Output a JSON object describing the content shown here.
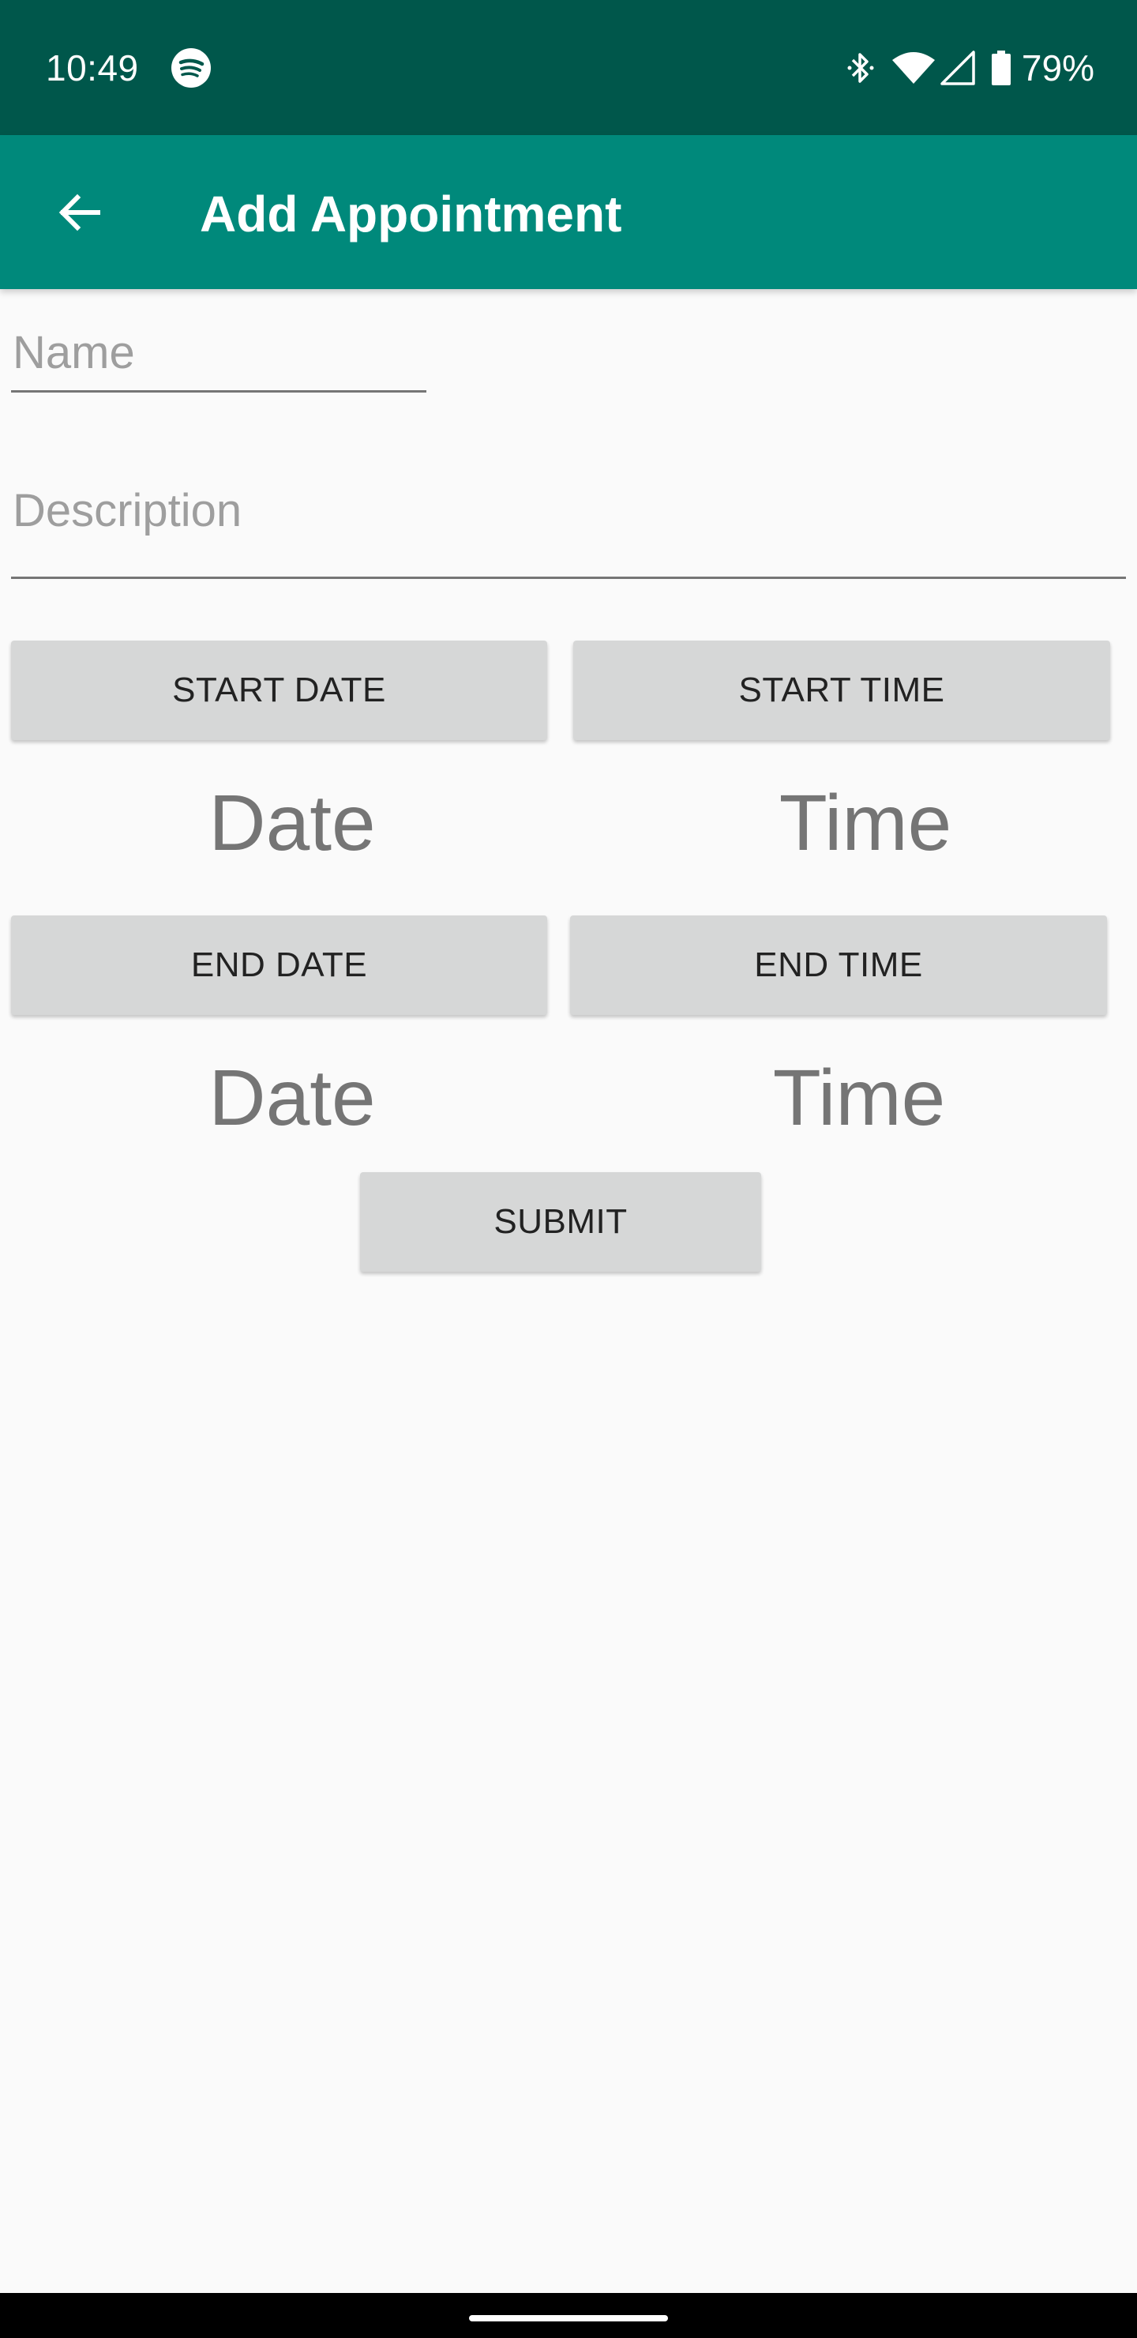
{
  "status_bar": {
    "time": "10:49",
    "battery": "79%",
    "icons": [
      "spotify-icon",
      "bluetooth-icon",
      "wifi-icon",
      "signal-icon",
      "battery-icon"
    ]
  },
  "app_bar": {
    "title": "Add Appointment",
    "back_icon": "arrow-back-icon",
    "color": "#00897b"
  },
  "form": {
    "name_placeholder": "Name",
    "description_placeholder": "Description",
    "start_date_button": "START DATE",
    "start_time_button": "START TIME",
    "start_date_value": "Date",
    "start_time_value": "Time",
    "end_date_button": "END DATE",
    "end_time_button": "END TIME",
    "end_date_value": "Date",
    "end_time_value": "Time",
    "submit_button": "SUBMIT"
  },
  "colors": {
    "status_bar": "#00574b",
    "app_bar": "#00897b",
    "background": "#fafafa",
    "button": "#d6d7d7"
  }
}
